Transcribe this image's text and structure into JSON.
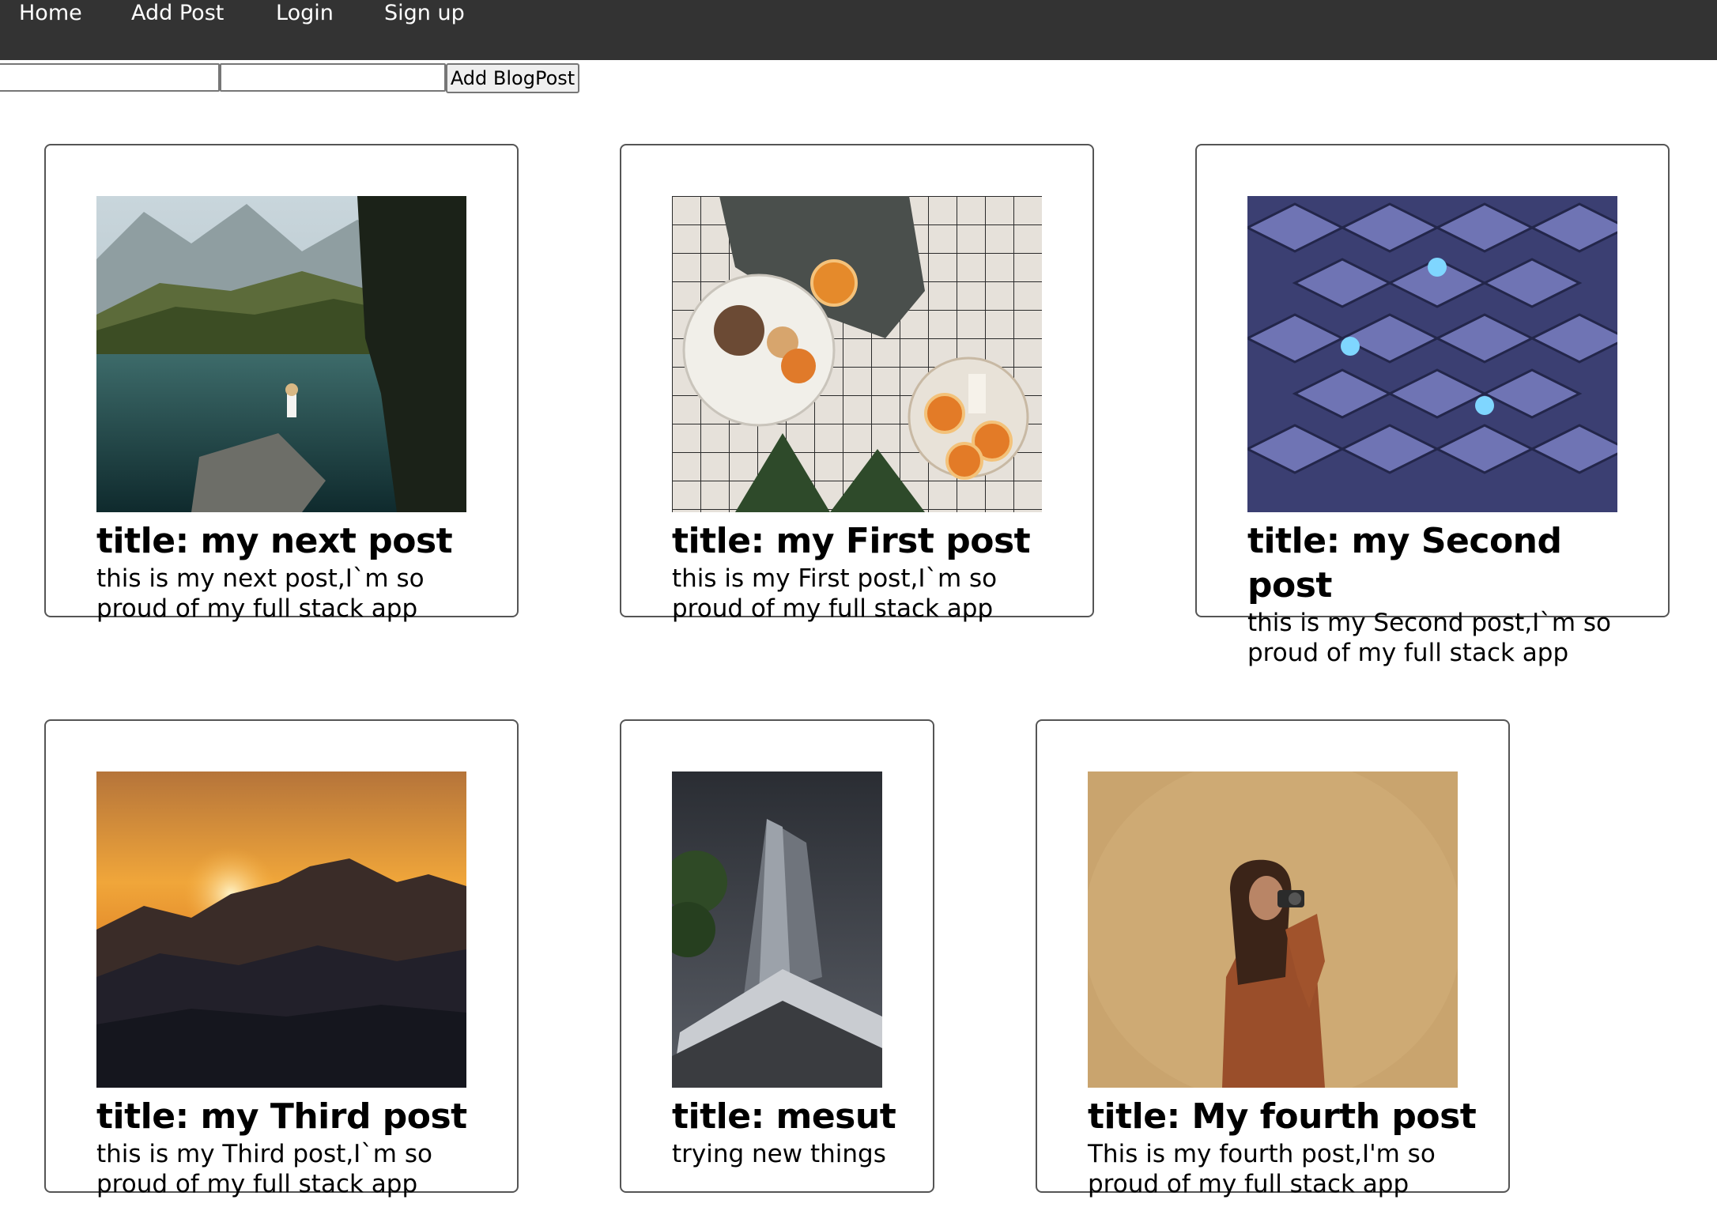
{
  "nav": {
    "items": [
      "Home",
      "Add Post",
      "Login",
      "Sign up"
    ]
  },
  "form": {
    "title_value": "",
    "body_value": "",
    "submit_label": "Add BlogPost"
  },
  "posts": [
    {
      "title": "title: my next post",
      "body": "this is my next post,I`m so proud of my full stack app",
      "image": "lake-mountain-woman"
    },
    {
      "title": "title: my First post",
      "body": "this is my First post,I`m so proud of my full stack app",
      "image": "plate-oranges-table"
    },
    {
      "title": "title: my Second post",
      "body": "this is my Second post,I`m so proud of my full stack app",
      "image": "office-cubicles"
    },
    {
      "title": "title: my Third post",
      "body": "this is my Third post,I`m so proud of my full stack app",
      "image": "mountain-sunset"
    },
    {
      "title": "title: mesut",
      "body": "trying new things",
      "image": "skyscraper-night"
    },
    {
      "title": "title: My fourth post",
      "body": "This is my fourth post,I'm so proud of my full stack app",
      "image": "woman-camera"
    }
  ]
}
